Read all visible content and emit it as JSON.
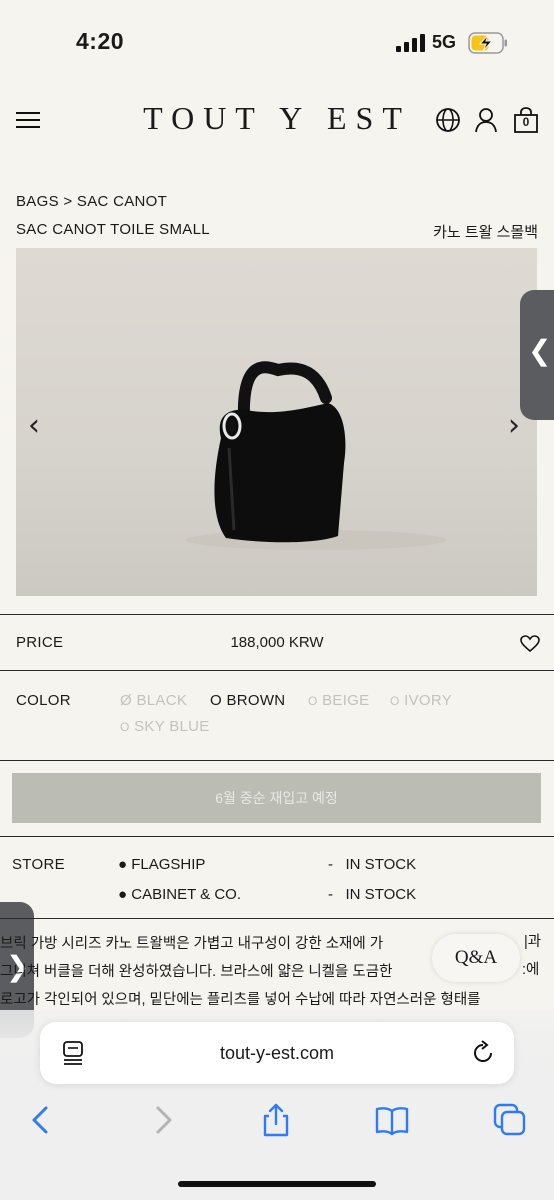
{
  "status": {
    "time": "4:20",
    "network": "5G"
  },
  "header": {
    "logo": "TOUT Y EST",
    "cart_count": "0"
  },
  "breadcrumb": {
    "category": "BAGS",
    "separator": ">",
    "sub": "SAC CANOT"
  },
  "product": {
    "name": "SAC CANOT TOILE SMALL",
    "name_kr": "카노 트왈 스몰백"
  },
  "price": {
    "label": "PRICE",
    "value": "188,000 KRW"
  },
  "color": {
    "label": "COLOR",
    "options": [
      {
        "mark": "Ø",
        "name": "BLACK"
      },
      {
        "mark": "O",
        "name": "BROWN"
      },
      {
        "mark": "O",
        "name": "BEIGE"
      },
      {
        "mark": "O",
        "name": "IVORY"
      },
      {
        "mark": "O",
        "name": "SKY BLUE"
      }
    ],
    "selected": "BROWN"
  },
  "restock_button": "6월 중순 재입고 예정",
  "store": {
    "label": "STORE",
    "rows": [
      {
        "name": "FLAGSHIP",
        "dash": "-",
        "status": "IN STOCK"
      },
      {
        "name": "CABINET & CO.",
        "dash": "-",
        "status": "IN STOCK"
      }
    ]
  },
  "description": [
    "브릭 가방 시리즈 카노 트왈백은 가볍고 내구성이 강한 소재에 가",
    "그니쳐 버클을 더해 완성하였습니다. 브라스에 얇은 니켈을 도금한",
    "로고가 각인되어 있으며, 밑단에는 플리츠를 넣어 수납에 따라 자연스러운 형태를",
    "    ..."
  ],
  "description_tail": [
    "|과",
    ":에"
  ],
  "qa_label": "Q&A",
  "browser": {
    "url": "tout-y-est.com"
  },
  "colors": {
    "background": "#f6f4ee",
    "button_disabled": "#bbbdb5",
    "ios_blue": "#2f7bf5"
  }
}
